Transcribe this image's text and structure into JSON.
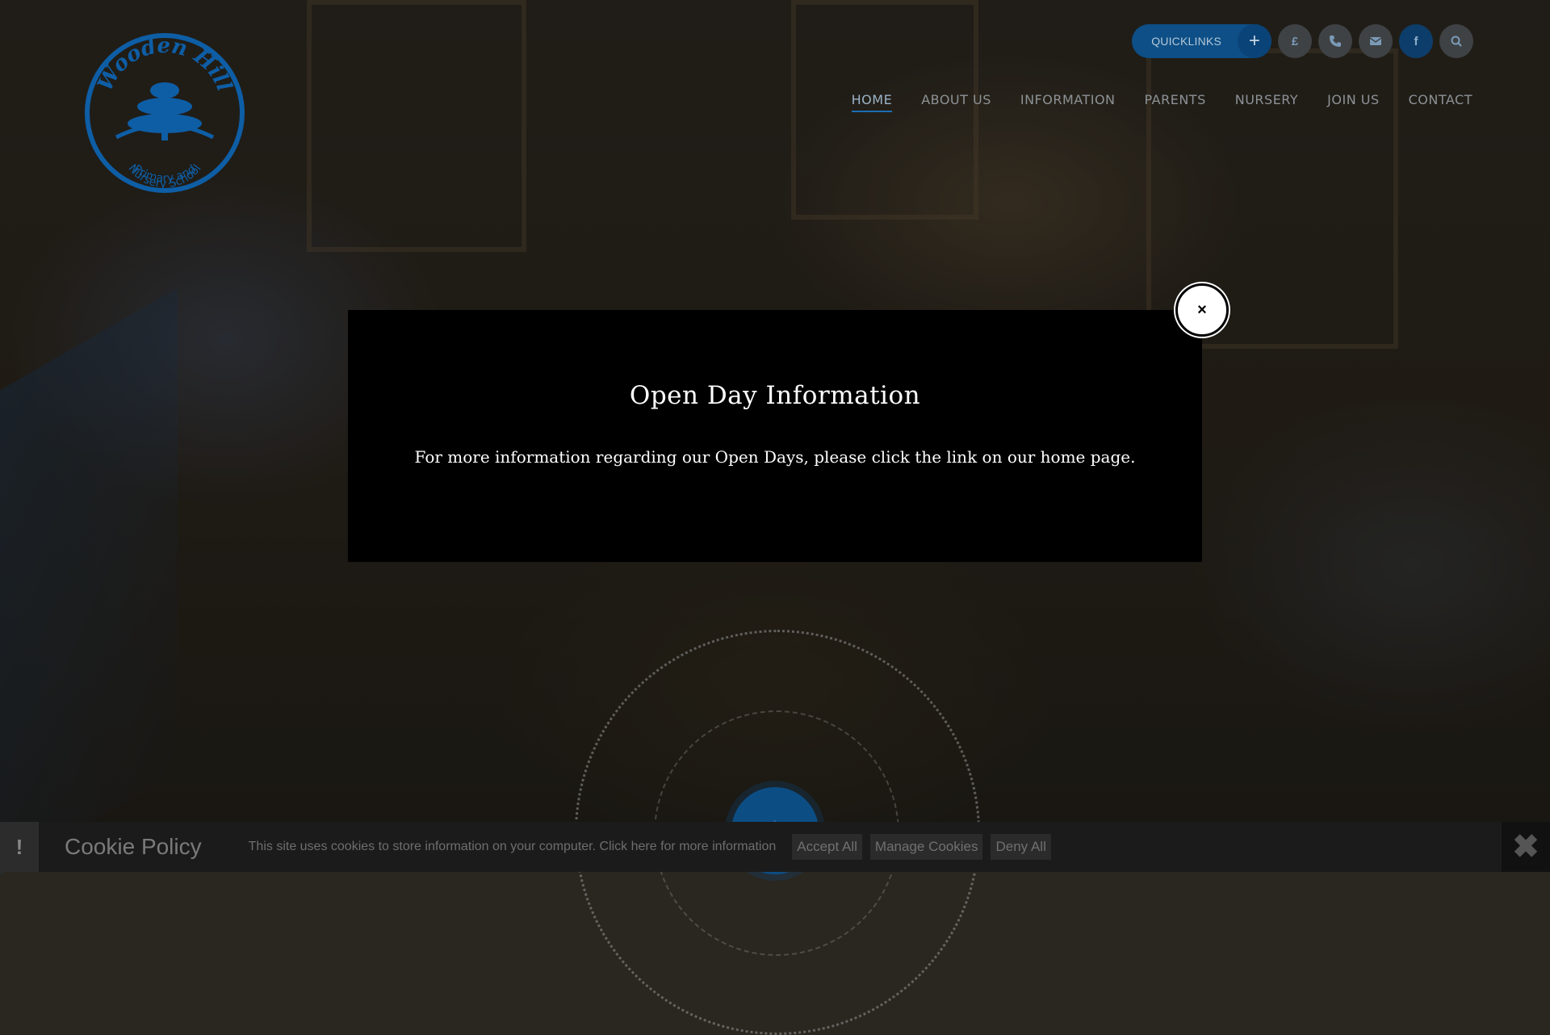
{
  "logo": {
    "name": "Wooden Hill",
    "subtitle_line1": "Primary and",
    "subtitle_line2": "Nursery School"
  },
  "topbar": {
    "quicklinks_label": "QUICKLINKS",
    "quicklinks_icon": "plus-icon",
    "buttons": [
      {
        "name": "pound-icon",
        "glyph": "£"
      },
      {
        "name": "phone-icon"
      },
      {
        "name": "email-icon"
      },
      {
        "name": "facebook-icon",
        "glyph": "f"
      },
      {
        "name": "search-icon"
      }
    ]
  },
  "nav": {
    "items": [
      "HOME",
      "ABOUT US",
      "INFORMATION",
      "PARENTS",
      "NURSERY",
      "JOIN US",
      "CONTACT"
    ],
    "active": "HOME"
  },
  "modal": {
    "title": "Open Day Information",
    "body": "For more information regarding our Open Days, please click the link on our home page.",
    "close_glyph": "×"
  },
  "scroll_button": {
    "glyph": "↓"
  },
  "cookie_bar": {
    "alert_glyph": "!",
    "title": "Cookie Policy",
    "text": "This site uses cookies to store information on your computer. Click here for more information",
    "accept_label": "Accept All",
    "manage_label": "Manage Cookies",
    "deny_label": "Deny All",
    "close_glyph": "✖"
  },
  "colors": {
    "brand_blue": "#0d4f86",
    "modal_bg": "#000000",
    "nav_active_underline": "#1b6eb5"
  }
}
